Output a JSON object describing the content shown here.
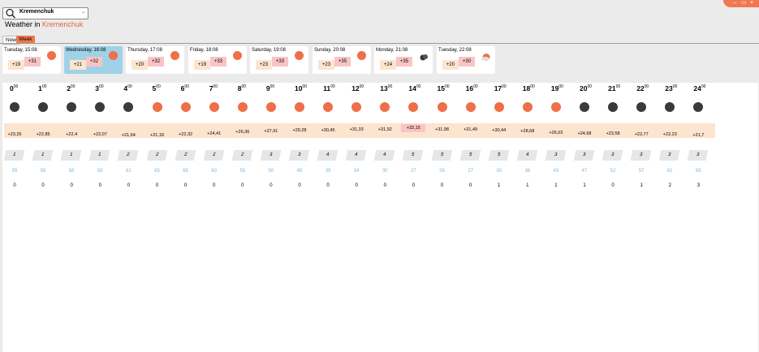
{
  "search": {
    "value": "Kremenchuk"
  },
  "heading": {
    "prefix": "Weather in",
    "city": "Kremenchuk"
  },
  "tabs": {
    "now": "Now",
    "week": "Week"
  },
  "window": {
    "min": "–",
    "max": "▭",
    "close": "×"
  },
  "days": [
    {
      "title": "Tuesday, 15:08",
      "min": "+19",
      "max": "+31",
      "icon": "sun-icon"
    },
    {
      "title": "Wednesday, 16:08",
      "min": "+21",
      "max": "+32",
      "icon": "sun-icon"
    },
    {
      "title": "Thursday, 17:08",
      "min": "+20",
      "max": "+32",
      "icon": "sun-icon"
    },
    {
      "title": "Friday, 18:08",
      "min": "+19",
      "max": "+33",
      "icon": "sun-icon"
    },
    {
      "title": "Saturday, 19:08",
      "min": "+23",
      "max": "+33",
      "icon": "sun-icon"
    },
    {
      "title": "Sunday, 20:08",
      "min": "+23",
      "max": "+35",
      "icon": "sun-icon"
    },
    {
      "title": "Monday, 21:08",
      "min": "+24",
      "max": "+35",
      "icon": "cloud-icon"
    },
    {
      "title": "Tuesday, 22:08",
      "min": "+20",
      "max": "+30",
      "icon": "sun-cloud-icon"
    }
  ],
  "hours": [
    {
      "h": "0",
      "temp": "+23,25",
      "wind": "1",
      "hum": "55",
      "prec": "0",
      "icon": "moon"
    },
    {
      "h": "1",
      "temp": "+22,85",
      "wind": "1",
      "hum": "56",
      "prec": "0",
      "icon": "moon"
    },
    {
      "h": "2",
      "temp": "+22,4",
      "wind": "1",
      "hum": "58",
      "prec": "0",
      "icon": "moon"
    },
    {
      "h": "3",
      "temp": "+22,07",
      "wind": "1",
      "hum": "59",
      "prec": "0",
      "icon": "moon"
    },
    {
      "h": "4",
      "temp": "+21,64",
      "wind": "2",
      "hum": "61",
      "prec": "0",
      "icon": "moon"
    },
    {
      "h": "5",
      "temp": "+21,18",
      "wind": "2",
      "hum": "65",
      "prec": "0",
      "icon": "sun"
    },
    {
      "h": "6",
      "temp": "+22,32",
      "wind": "2",
      "hum": "65",
      "prec": "0",
      "icon": "sun"
    },
    {
      "h": "7",
      "temp": "+24,41",
      "wind": "2",
      "hum": "60",
      "prec": "0",
      "icon": "sun"
    },
    {
      "h": "8",
      "temp": "+26,36",
      "wind": "2",
      "hum": "55",
      "prec": "0",
      "icon": "sun"
    },
    {
      "h": "9",
      "temp": "+27,91",
      "wind": "3",
      "hum": "50",
      "prec": "0",
      "icon": "sun"
    },
    {
      "h": "10",
      "temp": "+29,28",
      "wind": "3",
      "hum": "45",
      "prec": "0",
      "icon": "sun"
    },
    {
      "h": "11",
      "temp": "+30,45",
      "wind": "4",
      "hum": "39",
      "prec": "0",
      "icon": "sun"
    },
    {
      "h": "12",
      "temp": "+31,33",
      "wind": "4",
      "hum": "34",
      "prec": "0",
      "icon": "sun"
    },
    {
      "h": "13",
      "temp": "+31,92",
      "wind": "4",
      "hum": "30",
      "prec": "0",
      "icon": "sun"
    },
    {
      "h": "14",
      "temp": "+32,15",
      "wind": "5",
      "hum": "27",
      "prec": "0",
      "icon": "sun"
    },
    {
      "h": "15",
      "temp": "+31,98",
      "wind": "5",
      "hum": "26",
      "prec": "0",
      "icon": "sun"
    },
    {
      "h": "16",
      "temp": "+31,49",
      "wind": "5",
      "hum": "27",
      "prec": "0",
      "icon": "sun"
    },
    {
      "h": "17",
      "temp": "+30,44",
      "wind": "5",
      "hum": "30",
      "prec": "1",
      "icon": "sun"
    },
    {
      "h": "18",
      "temp": "+28,68",
      "wind": "4",
      "hum": "36",
      "prec": "1",
      "icon": "sun"
    },
    {
      "h": "19",
      "temp": "+26,03",
      "wind": "3",
      "hum": "43",
      "prec": "1",
      "icon": "sun"
    },
    {
      "h": "20",
      "temp": "+24,68",
      "wind": "3",
      "hum": "47",
      "prec": "1",
      "icon": "moon"
    },
    {
      "h": "21",
      "temp": "+23,58",
      "wind": "3",
      "hum": "52",
      "prec": "0",
      "icon": "moon"
    },
    {
      "h": "22",
      "temp": "+22,77",
      "wind": "3",
      "hum": "57",
      "prec": "1",
      "icon": "moon"
    },
    {
      "h": "23",
      "temp": "+22,23",
      "wind": "3",
      "hum": "61",
      "prec": "2",
      "icon": "moon"
    },
    {
      "h": "24",
      "temp": "+21,7",
      "wind": "3",
      "hum": "65",
      "prec": "3",
      "icon": "moon"
    }
  ],
  "hour_suffix": "00",
  "colors": {
    "accent": "#f07850",
    "sun": "#ee6f48",
    "moon": "#3a3a3a",
    "selected": "#9fd2e6",
    "humidity": "#77b8e6"
  }
}
